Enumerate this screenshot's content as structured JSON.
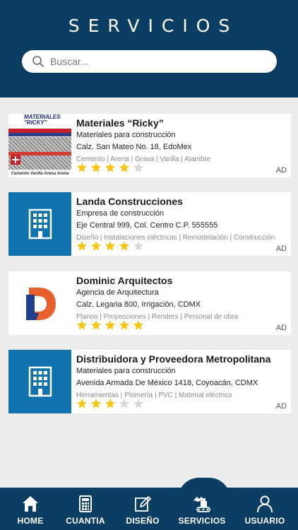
{
  "header": {
    "title": "SERVICIOS"
  },
  "search": {
    "placeholder": "Buscar..."
  },
  "listings": [
    {
      "name": "Materiales “Ricky”",
      "type": "Materiales para construcción",
      "address": "Calz. San Mateo No. 18, EdoMex",
      "tags": "Cemento | Arena | Grava | Varilla | Alambre",
      "rating": 4,
      "ad": "AD",
      "image": "materiales-ricky-ad",
      "image_text": {
        "brand": "MATERIALES \"RICKY\"",
        "footer": "Cemento Varilla Arena Arena"
      }
    },
    {
      "name": "Landa Construcciones",
      "type": "Empresa de construcción",
      "address": "Eje Central 999, Col. Centro C.P. 555555",
      "tags": "Diseño | Instalaciones eléctricas | Remodelación | Construcción",
      "rating": 4,
      "ad": "AD",
      "image": "building-icon"
    },
    {
      "name": "Dominic Arquitectos",
      "type": "Agencia de Arquitectura",
      "address": "Calz. Legaria 800, Irrigación, CDMX",
      "tags": "Planos | Proyecciones | Renders | Personal de obra",
      "rating": 5,
      "ad": "AD",
      "image": "dominic-logo"
    },
    {
      "name": "Distribuidora y Proveedora Metropolitana",
      "type": "Materiales para construcción",
      "address": "Avenida Armada De México 1418, Coyoacán, CDMX",
      "tags": "Herramientas | Plomería | PVC | Material eléctrico",
      "rating": 3,
      "ad": "AD",
      "image": "building-icon"
    }
  ],
  "nav": {
    "items": [
      {
        "label": "HOME",
        "icon": "home-icon"
      },
      {
        "label": "CUANTIA",
        "icon": "calculator-icon"
      },
      {
        "label": "DISEÑO",
        "icon": "edit-icon"
      },
      {
        "label": "SERVICIOS",
        "icon": "excavator-icon",
        "active": true
      },
      {
        "label": "USUARIO",
        "icon": "user-icon"
      }
    ]
  },
  "colors": {
    "primary": "#0c3e63",
    "accent": "#1173ad",
    "star": "#f5c518",
    "star_empty": "#d9d9d9"
  }
}
